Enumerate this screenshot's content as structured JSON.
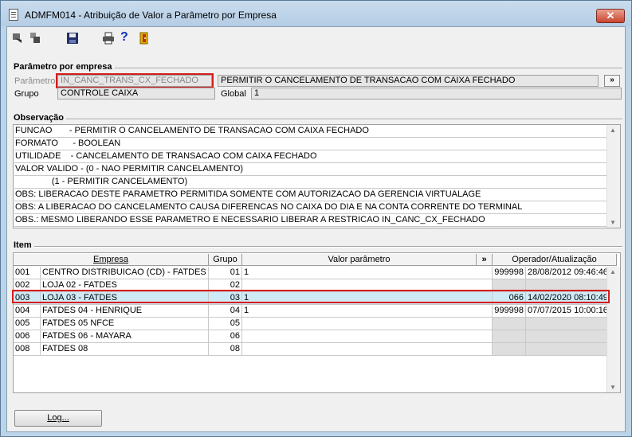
{
  "window": {
    "title": "ADMFM014 - Atribuição de Valor a Parâmetro por Empresa",
    "close_glyph": "✕"
  },
  "toolbar": {
    "help_glyph": "?"
  },
  "parametro_section": {
    "label": "Parâmetro por empresa",
    "parametro_label": "Parâmetro",
    "parametro_code": "IN_CANC_TRANS_CX_FECHADO",
    "parametro_desc": "PERMITIR O CANCELAMENTO DE TRANSACAO COM CAIXA FECHADO",
    "expand_button": "»",
    "grupo_label": "Grupo",
    "grupo_value": "CONTROLE CAIXA",
    "global_label": "Global",
    "global_value": "1"
  },
  "observacao": {
    "label": "Observação",
    "lines": [
      "FUNCAO       - PERMITIR O CANCELAMENTO DE TRANSACAO COM CAIXA FECHADO",
      "FORMATO      - BOOLEAN",
      "UTILIDADE    - CANCELAMENTO DE TRANSACAO COM CAIXA FECHADO",
      "VALOR VALIDO - (0 - NAO PERMITIR CANCELAMENTO)",
      "               (1 - PERMITIR CANCELAMENTO)",
      "OBS: LIBERACAO DESTE PARAMETRO PERMITIDA SOMENTE COM AUTORIZACAO DA GERENCIA VIRTUALAGE",
      "OBS: A LIBERACAO DO CANCELAMENTO CAUSA DIFERENCAS NO CAIXA DO DIA E NA CONTA CORRENTE DO TERMINAL",
      "OBS.: MESMO LIBERANDO ESSE PARAMETRO E NECESSARIO LIBERAR A RESTRICAO IN_CANC_CX_FECHADO"
    ]
  },
  "item": {
    "label": "Item",
    "headers": {
      "empresa": "Empresa",
      "grupo": "Grupo",
      "valor": "Valor parâmetro",
      "expand": "»",
      "operador": "Operador/Atualização"
    },
    "rows": [
      {
        "cod": "001",
        "empresa": "CENTRO DISTRIBUICAO (CD) - FATDES",
        "grupo": "01",
        "valor": "1",
        "operador": "999998",
        "data": "28/08/2012 09:46:46"
      },
      {
        "cod": "002",
        "empresa": "LOJA 02 - FATDES",
        "grupo": "02",
        "valor": "",
        "operador": "",
        "data": ""
      },
      {
        "cod": "003",
        "empresa": "LOJA 03 - FATDES",
        "grupo": "03",
        "valor": "1",
        "operador": "066",
        "data": "14/02/2020 08:10:49"
      },
      {
        "cod": "004",
        "empresa": "FATDES 04 - HENRIQUE",
        "grupo": "04",
        "valor": "1",
        "operador": "999998",
        "data": "07/07/2015 10:00:16"
      },
      {
        "cod": "005",
        "empresa": "FATDES 05 NFCE",
        "grupo": "05",
        "valor": "",
        "operador": "",
        "data": ""
      },
      {
        "cod": "006",
        "empresa": "FATDES 06 - MAYARA",
        "grupo": "06",
        "valor": "",
        "operador": "",
        "data": ""
      },
      {
        "cod": "008",
        "empresa": "FATDES 08",
        "grupo": "08",
        "valor": "",
        "operador": "",
        "data": ""
      }
    ]
  },
  "footer": {
    "log_button": "Log..."
  },
  "colors": {
    "highlight": "#d61c1c",
    "selected_row": "#cfeaf7",
    "frame": "#bcd4e8"
  }
}
